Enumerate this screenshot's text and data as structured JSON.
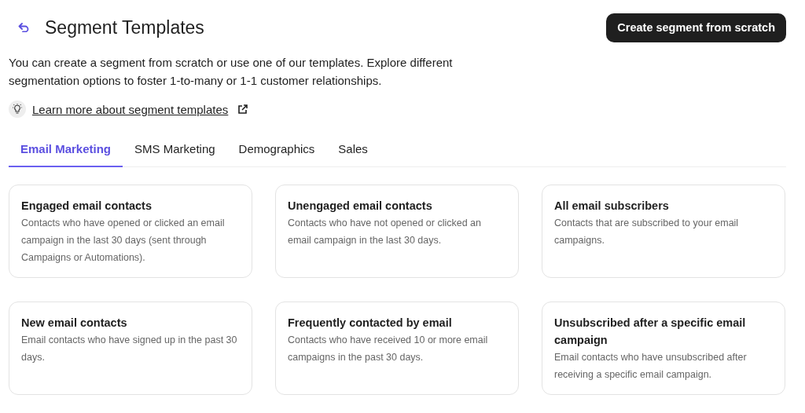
{
  "header": {
    "title": "Segment Templates",
    "primary_button": "Create segment from scratch"
  },
  "description": "You can create a segment from scratch or use one of our templates. Explore different segmentation options to foster 1-to-many or 1-1 customer relationships.",
  "help_link": "Learn more about segment templates",
  "tabs": [
    {
      "label": "Email Marketing",
      "selected": true
    },
    {
      "label": "SMS Marketing",
      "selected": false
    },
    {
      "label": "Demographics",
      "selected": false
    },
    {
      "label": "Sales",
      "selected": false
    }
  ],
  "templates": [
    {
      "title": "Engaged email contacts",
      "description": "Contacts who have opened or clicked an email campaign in the last 30 days (sent through Campaigns or Automations)."
    },
    {
      "title": "Unengaged email contacts",
      "description": "Contacts who have not opened or clicked an email campaign in the last 30 days."
    },
    {
      "title": "All email subscribers",
      "description": "Contacts that are subscribed to your email campaigns."
    },
    {
      "title": "New email contacts",
      "description": "Email contacts who have signed up in the past 30 days."
    },
    {
      "title": "Frequently contacted by email",
      "description": "Contacts who have received 10 or more email campaigns in the past 30 days."
    },
    {
      "title": "Unsubscribed after a specific email campaign",
      "description": "Email contacts who have unsubscribed after receiving a specific email campaign."
    }
  ]
}
